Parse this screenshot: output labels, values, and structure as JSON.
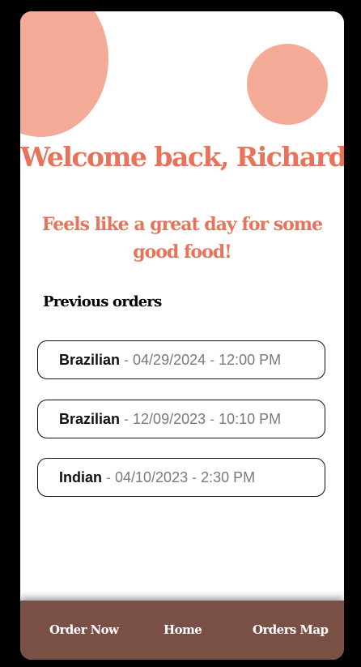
{
  "header": {
    "welcome": "Welcome back, Richard!",
    "tagline": "Feels like a great day for some good food!"
  },
  "previous_orders": {
    "title": "Previous orders",
    "items": [
      {
        "cuisine": "Brazilian",
        "date": "04/29/2024",
        "time": "12:00 PM"
      },
      {
        "cuisine": "Brazilian",
        "date": "12/09/2023",
        "time": "10:10 PM"
      },
      {
        "cuisine": "Indian",
        "date": "04/10/2023",
        "time": "2:30 PM"
      }
    ]
  },
  "nav": {
    "items": [
      {
        "label": "Order Now"
      },
      {
        "label": "Home"
      },
      {
        "label": "Orders Map"
      }
    ]
  },
  "colors": {
    "accent": "#e8735a",
    "decor_circle": "#f3ab98",
    "navbar": "#7a5046",
    "background": "#000000"
  }
}
